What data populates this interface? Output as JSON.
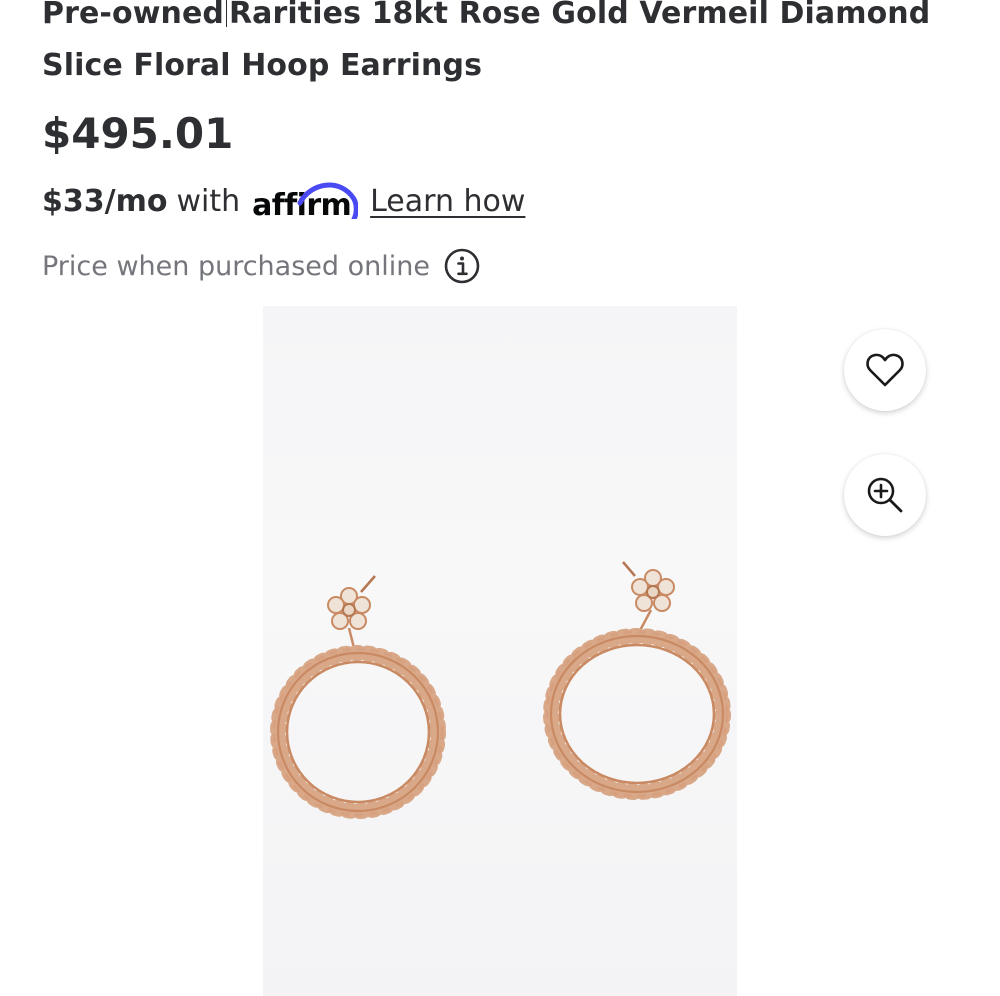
{
  "product": {
    "title_part1": "Pre-owned",
    "title_part2": "Rarities 18kt Rose Gold Vermeil Diamond Slice Floral Hoop Earrings",
    "price": "$495.01",
    "image_alt": "Rarities 18kt Rose Gold Vermeil Diamond Slice Floral Hoop Earrings"
  },
  "financing": {
    "monthly": "$33/mo",
    "with_text": "with",
    "provider_logo_text": "affirm",
    "learn_link": "Learn how"
  },
  "price_note": {
    "text": "Price when purchased online",
    "icon": "info-icon"
  },
  "actions": {
    "favorite_icon": "heart-icon",
    "zoom_icon": "zoom-in-icon"
  },
  "colors": {
    "text": "#2e2f32",
    "muted": "#74767c",
    "affirm_arc": "#4a4af4",
    "rose_gold": "#c98a63"
  }
}
